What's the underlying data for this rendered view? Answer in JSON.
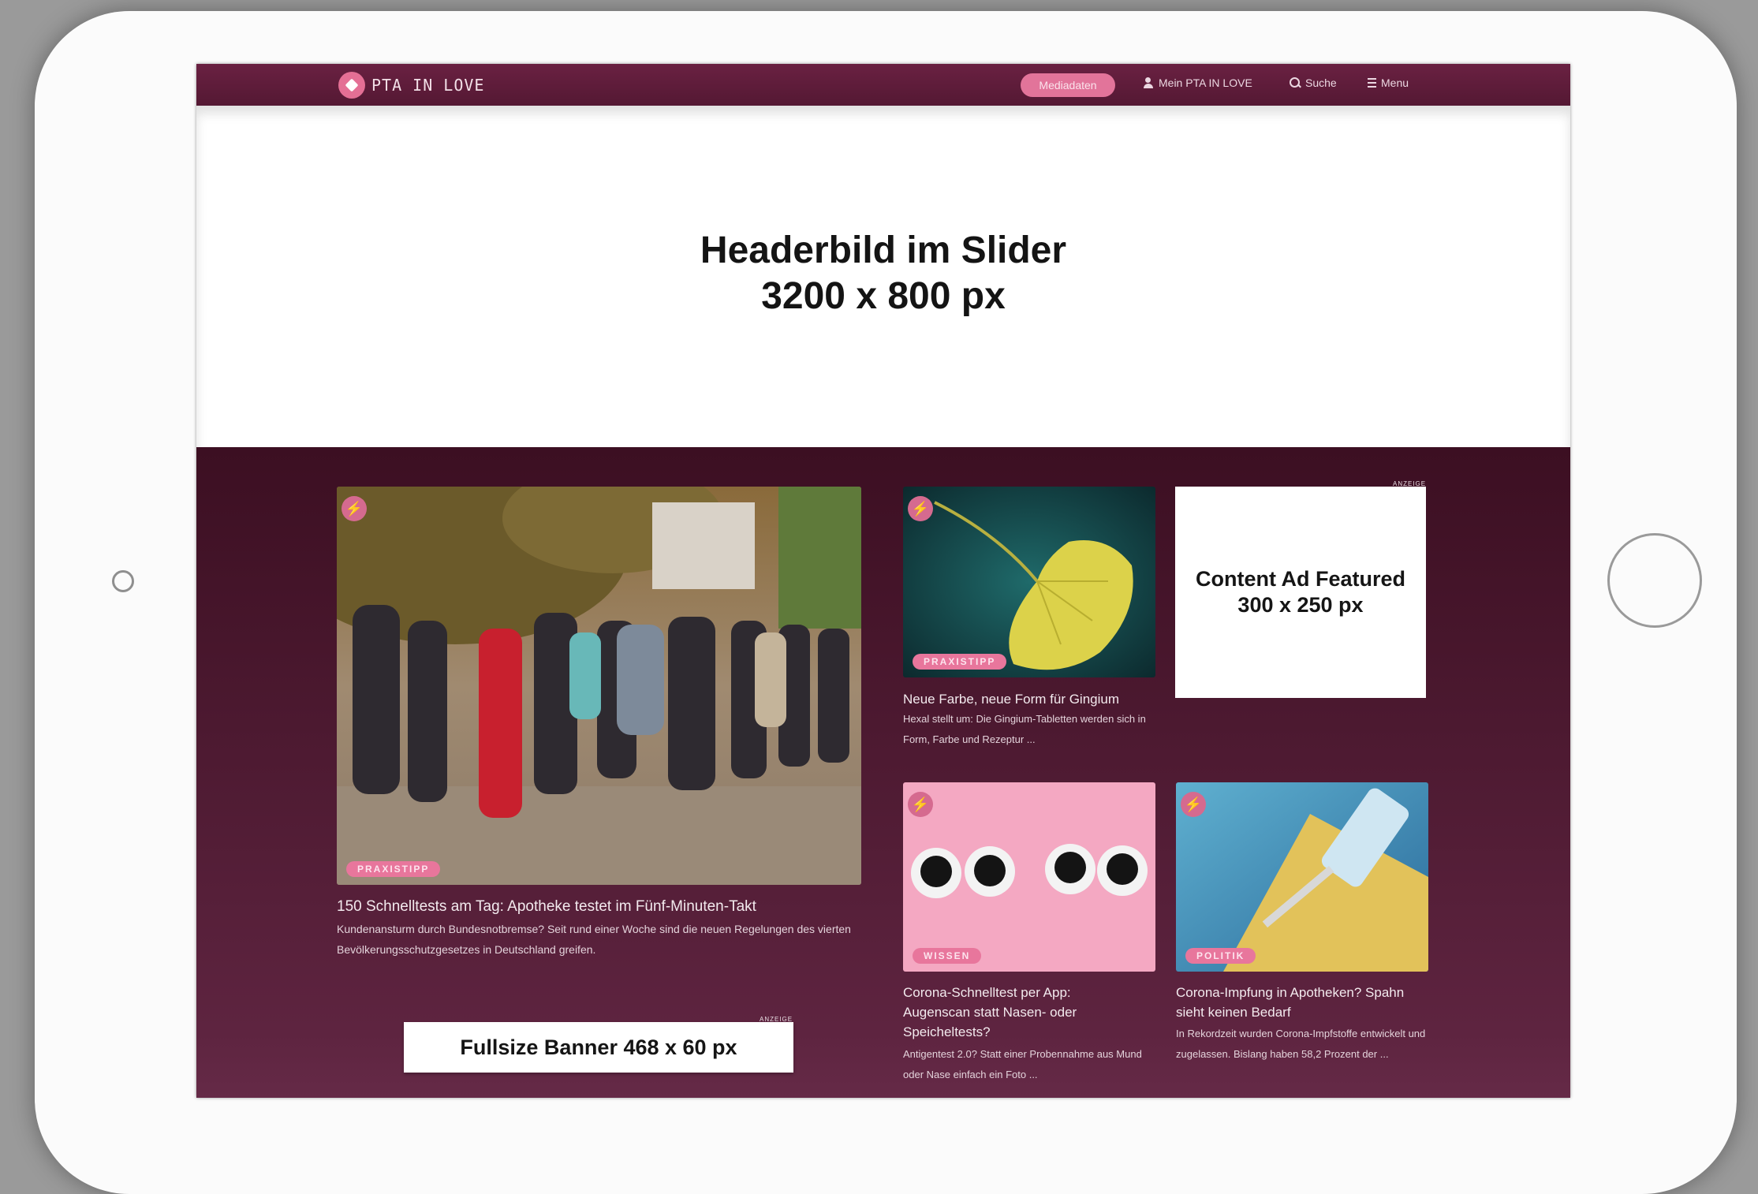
{
  "nav": {
    "logo_text": "PTA IN LOVE",
    "pill_label": "Mediadaten",
    "account_label": "Mein PTA IN LOVE",
    "search_label": "Suche",
    "menu_label": "Menu"
  },
  "slider": {
    "line1": "Headerbild im Slider",
    "line2": "3200 x 800 px"
  },
  "ads": {
    "featured_label": "ANZEIGE",
    "featured_line1": "Content Ad Featured",
    "featured_line2": "300 x 250 px",
    "banner_label": "ANZEIGE",
    "banner_text": "Fullsize Banner 468 x 60 px"
  },
  "articles": [
    {
      "tag": "PRAXISTIPP",
      "title": "150 Schnelltests am Tag: Apotheke testet im Fünf-Minuten-Takt",
      "excerpt": "Kundenansturm durch Bundesnotbremse? Seit rund einer Woche sind die neuen Regelungen des vierten Bevölkerungsschutzgesetzes in Deutschland greifen."
    },
    {
      "tag": "PRAXISTIPP",
      "title": "Neue Farbe, neue Form für Gingium",
      "excerpt": "Hexal stellt um: Die Gingium-Tabletten werden sich in Form, Farbe und Rezeptur ..."
    },
    {
      "tag": "WISSEN",
      "title": "Corona-Schnelltest per App: Augenscan statt Nasen- oder Speicheltests?",
      "excerpt": "Antigentest 2.0? Statt einer Probennahme aus Mund oder Nase einfach ein Foto ..."
    },
    {
      "tag": "POLITIK",
      "title": "Corona-Impfung in Apotheken? Spahn sieht keinen Bedarf",
      "excerpt": "In Rekordzeit wurden Corona-Impfstoffe entwickelt und zugelassen. Bislang haben 58,2 Prozent der ..."
    }
  ],
  "icons": {
    "bolt": "⚡"
  },
  "colors": {
    "nav_bg": "#5e1c3a",
    "accent_pink": "#e8769c",
    "content_bg": "#4a1830"
  }
}
